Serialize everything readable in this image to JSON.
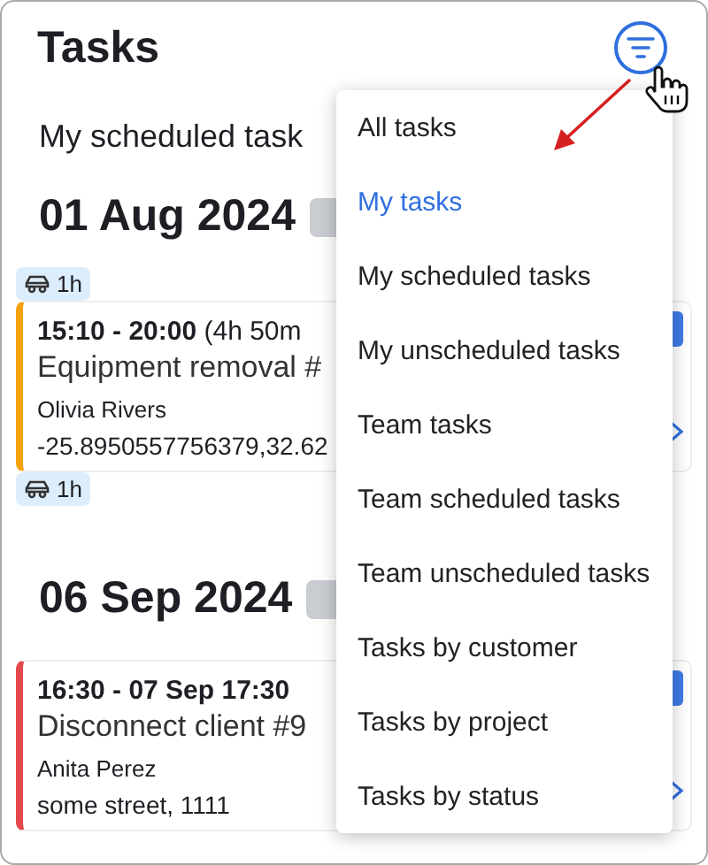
{
  "header": {
    "title": "Tasks"
  },
  "view_title": "My scheduled task",
  "groups": [
    {
      "date": "01 Aug 2024",
      "travel_before": "1h",
      "tasks": [
        {
          "time": "15:10 - 20:00",
          "duration": "(4h 50m",
          "title": "Equipment removal #",
          "assignee": "Olivia Rivers",
          "location": "-25.8950557756379,32.62",
          "color": "#f5a00f"
        }
      ],
      "travel_after": "1h"
    },
    {
      "date": "06 Sep 2024",
      "tasks": [
        {
          "time": "16:30 - 07 Sep 17:30",
          "title": "Disconnect client #9",
          "assignee": "Anita Perez",
          "location": "some street, 1111",
          "color": "#e5484d"
        }
      ]
    }
  ],
  "filter_menu": {
    "items": [
      {
        "label": "All tasks",
        "selected": false
      },
      {
        "label": "My tasks",
        "selected": true
      },
      {
        "label": "My scheduled tasks",
        "selected": false
      },
      {
        "label": "My unscheduled tasks",
        "selected": false
      },
      {
        "label": "Team tasks",
        "selected": false
      },
      {
        "label": "Team scheduled tasks",
        "selected": false
      },
      {
        "label": "Team unscheduled tasks",
        "selected": false
      },
      {
        "label": "Tasks by customer",
        "selected": false
      },
      {
        "label": "Tasks by project",
        "selected": false
      },
      {
        "label": "Tasks by status",
        "selected": false
      }
    ]
  }
}
